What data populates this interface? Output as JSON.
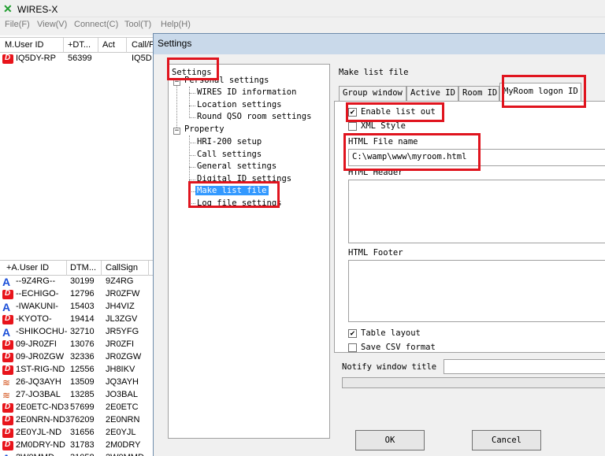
{
  "app": {
    "title": "WIRES-X"
  },
  "menu": [
    "File(F)",
    "View(V)",
    "Connect(C)",
    "Tool(T)",
    "Help(H)"
  ],
  "top_list": {
    "headers": [
      "M.User ID",
      "+DT...",
      "Act",
      "Call/F"
    ],
    "rows": [
      {
        "id": "IQ5DY-RP",
        "dtmf": "56399",
        "call": "IQ5D"
      }
    ]
  },
  "user_list": {
    "headers": [
      "+A.User ID",
      "DTM...",
      "CallSign"
    ],
    "rows": [
      {
        "icon": "a",
        "id": "--9Z4RG--",
        "dtmf": "30199",
        "call": "9Z4RG"
      },
      {
        "icon": "d",
        "id": "--ECHIGO-",
        "dtmf": "12796",
        "call": "JR0ZFW"
      },
      {
        "icon": "a",
        "id": "-IWAKUNI-",
        "dtmf": "15403",
        "call": "JH4VIZ"
      },
      {
        "icon": "d",
        "id": "-KYOTO-",
        "dtmf": "19414",
        "call": "JL3ZGV"
      },
      {
        "icon": "a",
        "id": "-SHIKOCHU-",
        "dtmf": "32710",
        "call": "JR5YFG"
      },
      {
        "icon": "d",
        "id": "09-JR0ZFI",
        "dtmf": "13076",
        "call": "JR0ZFI"
      },
      {
        "icon": "d",
        "id": "09-JR0ZGW",
        "dtmf": "32336",
        "call": "JR0ZGW"
      },
      {
        "icon": "d",
        "id": "1ST-RIG-ND",
        "dtmf": "12556",
        "call": "JH8IKV"
      },
      {
        "icon": "w",
        "id": "26-JQ3AYH",
        "dtmf": "13509",
        "call": "JQ3AYH"
      },
      {
        "icon": "w",
        "id": "27-JO3BAL",
        "dtmf": "13285",
        "call": "JO3BAL"
      },
      {
        "icon": "d",
        "id": "2E0ETC-ND3",
        "dtmf": "57699",
        "call": "2E0ETC"
      },
      {
        "icon": "d",
        "id": "2E0NRN-ND3",
        "dtmf": "76209",
        "call": "2E0NRN"
      },
      {
        "icon": "d",
        "id": "2E0YJL-ND",
        "dtmf": "31656",
        "call": "2E0YJL"
      },
      {
        "icon": "d",
        "id": "2M0DRY-ND",
        "dtmf": "31783",
        "call": "2M0DRY"
      },
      {
        "icon": "a",
        "id": "2W0MMD-...",
        "dtmf": "31058",
        "call": "2W0MMD"
      }
    ]
  },
  "dialog": {
    "title": "Settings",
    "tree": {
      "root": "Settings",
      "personal": "Personal settings",
      "personal_items": [
        "WIRES ID information",
        "Location settings",
        "Round QSO room settings"
      ],
      "property": "Property",
      "property_items": [
        "HRI-200 setup",
        "Call settings",
        "General settings",
        "Digital ID settings",
        "Make list file",
        "Log file settings"
      ]
    },
    "panel_title": "Make list file",
    "tabs": [
      "Group window",
      "Active ID",
      "Room ID",
      "MyRoom logon ID"
    ],
    "enable_list_out": "Enable list out",
    "xml_style": "XML Style",
    "html_file_name_label": "HTML File name",
    "html_file_name_value": "C:\\wamp\\www\\myroom.html",
    "html_header_label": "HTML Header",
    "html_footer_label": "HTML Footer",
    "table_layout": "Table layout",
    "save_csv": "Save CSV format",
    "notify_label": "Notify window title",
    "ok": "OK",
    "cancel": "Cancel"
  }
}
